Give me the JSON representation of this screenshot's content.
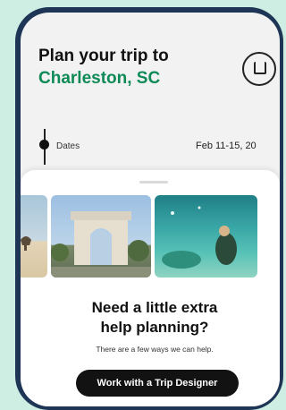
{
  "header": {
    "title_line1": "Plan your trip to",
    "title_line2": "Charleston, SC"
  },
  "trip": {
    "dates_label": "Dates",
    "dates_value": "Feb 11-15, 20"
  },
  "help_sheet": {
    "headline_line1": "Need a little extra",
    "headline_line2": "help planning?",
    "subtext": "There are a few ways we can help.",
    "cta_label": "Work with a Trip Designer"
  },
  "colors": {
    "accent_green": "#0f8a57",
    "phone_frame": "#1e3555",
    "background": "#cfeee3",
    "button": "#121212"
  }
}
